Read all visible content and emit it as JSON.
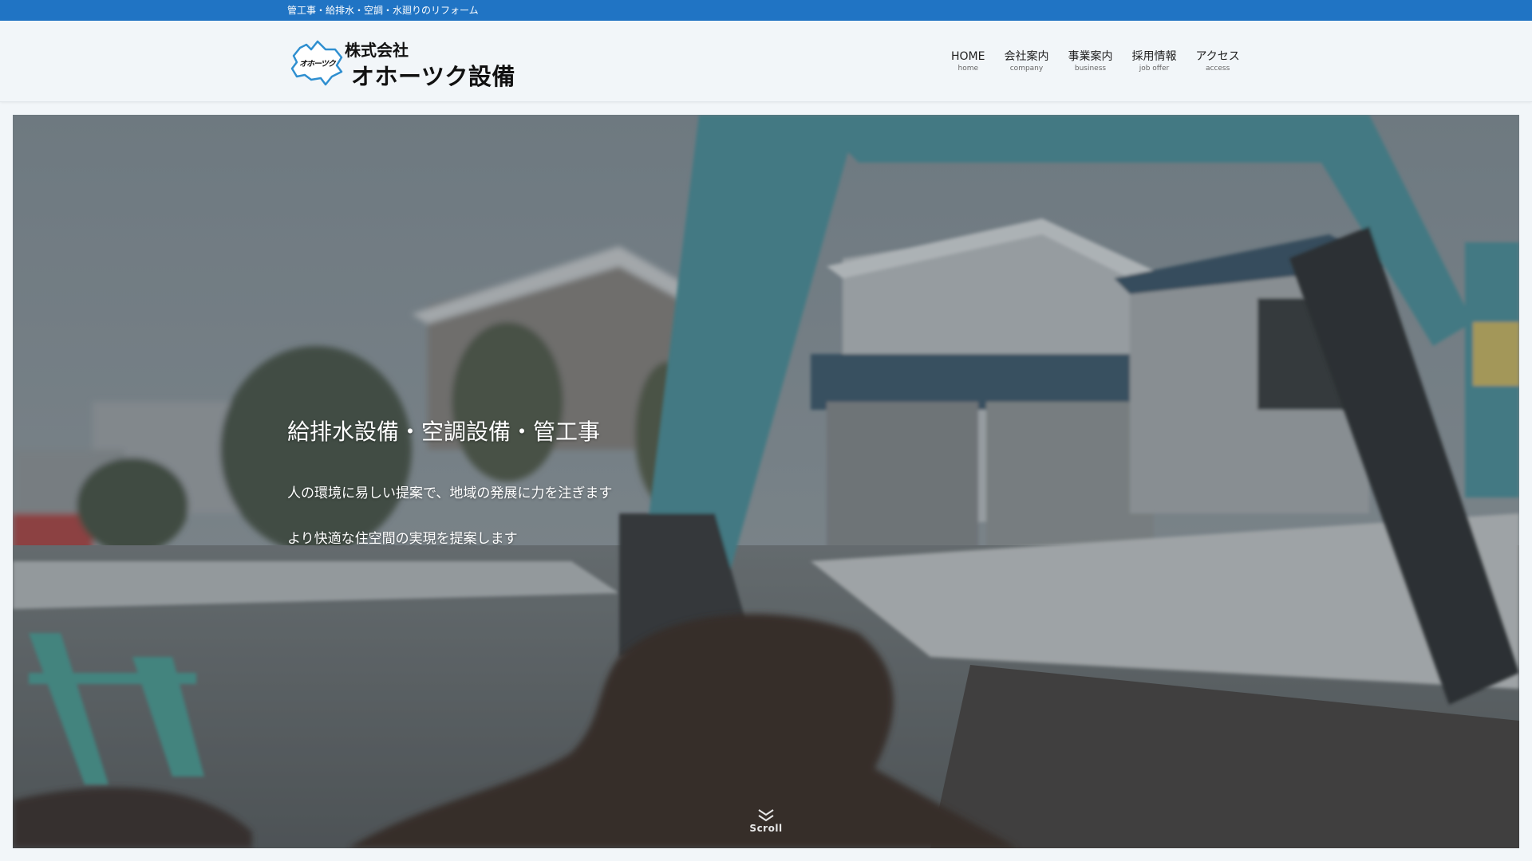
{
  "topbar": {
    "tagline": "管工事・給排水・空調・水廻りのリフォーム"
  },
  "header": {
    "logo_mark": "オホーツク",
    "logo_line1": "株式会社",
    "logo_line2": "オホーツク設備"
  },
  "nav": {
    "items": [
      {
        "label": "HOME",
        "sub": "home"
      },
      {
        "label": "会社案内",
        "sub": "company"
      },
      {
        "label": "事業案内",
        "sub": "business"
      },
      {
        "label": "採用情報",
        "sub": "job offer"
      },
      {
        "label": "アクセス",
        "sub": "access"
      }
    ]
  },
  "hero": {
    "title": "給排水設備・空調設備・管工事",
    "line1": "人の環境に易しい提案で、地域の発展に力を注ぎます",
    "line2": "より快適な住空間の実現を提案します",
    "scroll_label": "Scroll"
  },
  "colors": {
    "topbar": "#2074c4",
    "header_bg": "#f2f6f9",
    "excavator": "#4f9aa6",
    "soil": "#3d2f28"
  },
  "icons": {
    "scroll": "double-chevron-down-icon"
  }
}
